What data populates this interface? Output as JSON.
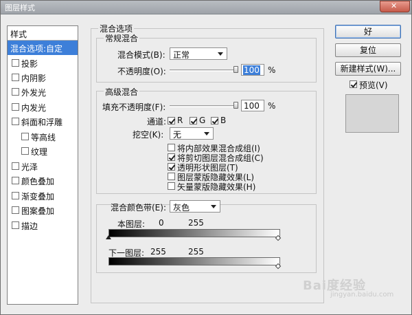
{
  "window": {
    "title": "图层样式",
    "close_icon": "close-icon"
  },
  "sidebar": {
    "header": "样式",
    "items": [
      {
        "label": "混合选项:自定",
        "selected": true,
        "checkbox": false
      },
      {
        "label": "投影",
        "checkbox": true,
        "checked": false
      },
      {
        "label": "内阴影",
        "checkbox": true,
        "checked": false
      },
      {
        "label": "外发光",
        "checkbox": true,
        "checked": false
      },
      {
        "label": "内发光",
        "checkbox": true,
        "checked": false
      },
      {
        "label": "斜面和浮雕",
        "checkbox": true,
        "checked": false
      },
      {
        "label": "等高线",
        "checkbox": true,
        "checked": false,
        "indent": true
      },
      {
        "label": "纹理",
        "checkbox": true,
        "checked": false,
        "indent": true
      },
      {
        "label": "光泽",
        "checkbox": true,
        "checked": false
      },
      {
        "label": "颜色叠加",
        "checkbox": true,
        "checked": false
      },
      {
        "label": "渐变叠加",
        "checkbox": true,
        "checked": false
      },
      {
        "label": "图案叠加",
        "checkbox": true,
        "checked": false
      },
      {
        "label": "描边",
        "checkbox": true,
        "checked": false
      }
    ]
  },
  "blending": {
    "section_title": "混合选项",
    "general": {
      "title": "常规混合",
      "mode_label": "混合模式(B):",
      "mode_value": "正常",
      "opacity_label": "不透明度(O):",
      "opacity_value": "100",
      "opacity_unit": "%",
      "opacity_fraction": 1.0
    },
    "advanced": {
      "title": "高级混合",
      "fill_label": "填充不透明度(F):",
      "fill_value": "100",
      "fill_unit": "%",
      "fill_fraction": 1.0,
      "channels_label": "通道:",
      "channels": [
        {
          "label": "R",
          "checked": true
        },
        {
          "label": "G",
          "checked": true
        },
        {
          "label": "B",
          "checked": true
        }
      ],
      "knockout_label": "挖空(K):",
      "knockout_value": "无",
      "options": [
        {
          "label": "将内部效果混合成组(I)",
          "checked": false
        },
        {
          "label": "将剪切图层混合成组(C)",
          "checked": true
        },
        {
          "label": "透明形状图层(T)",
          "checked": true
        },
        {
          "label": "图层蒙版隐藏效果(L)",
          "checked": false
        },
        {
          "label": "矢量蒙版隐藏效果(H)",
          "checked": false
        }
      ]
    },
    "blend_if": {
      "label": "混合颜色带(E):",
      "value": "灰色",
      "this_layer_label": "本图层:",
      "this_layer_low": "0",
      "this_layer_high": "255",
      "under_layer_label": "下一图层:",
      "under_layer_low": "255",
      "under_layer_high": "255"
    }
  },
  "buttons": {
    "ok": "好",
    "reset": "复位",
    "new_style": "新建样式(W)...",
    "preview_label": "预览(V)",
    "preview_checked": true
  },
  "watermark": {
    "text": "Bai度经验",
    "sub": "jingyan.baidu.com"
  }
}
